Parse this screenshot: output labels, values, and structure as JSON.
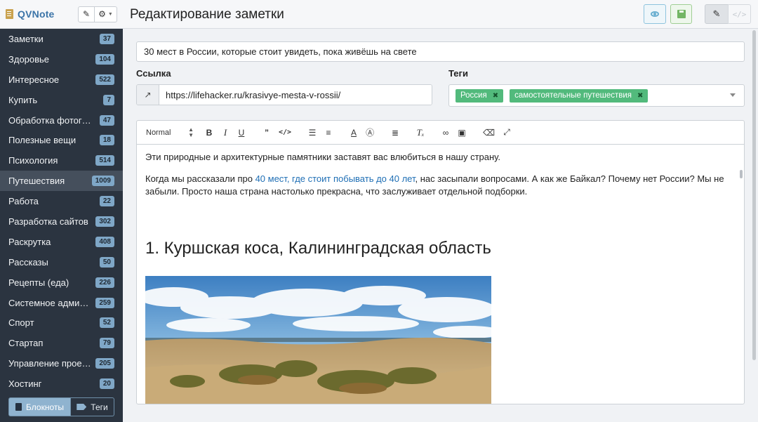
{
  "app": {
    "title": "QVNote"
  },
  "sidebar": {
    "items": [
      {
        "label": "Заметки",
        "count": "37"
      },
      {
        "label": "Здоровье",
        "count": "104"
      },
      {
        "label": "Интересное",
        "count": "522"
      },
      {
        "label": "Купить",
        "count": "7"
      },
      {
        "label": "Обработка фотографий",
        "count": "47"
      },
      {
        "label": "Полезные вещи",
        "count": "18"
      },
      {
        "label": "Психология",
        "count": "514"
      },
      {
        "label": "Путешествия",
        "count": "1009",
        "active": true
      },
      {
        "label": "Работа",
        "count": "22"
      },
      {
        "label": "Разработка сайтов",
        "count": "302"
      },
      {
        "label": "Раскрутка",
        "count": "408"
      },
      {
        "label": "Рассказы",
        "count": "50"
      },
      {
        "label": "Рецепты (еда)",
        "count": "226"
      },
      {
        "label": "Системное администрирование",
        "count": "259"
      },
      {
        "label": "Спорт",
        "count": "52"
      },
      {
        "label": "Стартап",
        "count": "79"
      },
      {
        "label": "Управление проектами",
        "count": "205"
      },
      {
        "label": "Хостинг",
        "count": "20"
      }
    ],
    "bottom": {
      "notebooks": "Блокноты",
      "tags": "Теги"
    }
  },
  "header": {
    "title": "Редактирование заметки"
  },
  "note": {
    "title": "30 мест в России, которые стоит увидеть, пока живёшь на свете",
    "link_label": "Ссылка",
    "link": "https://lifehacker.ru/krasivye-mesta-v-rossii/",
    "tags_label": "Теги",
    "tags": [
      "Россия",
      "самостоятельные путешествия"
    ]
  },
  "editor": {
    "format": "Normal",
    "toolbar_icons": [
      "bold-icon",
      "italic-icon",
      "underline-icon",
      "quote-icon",
      "code-icon",
      "ordered-list-icon",
      "bullet-list-icon",
      "font-color-icon",
      "background-color-icon",
      "align-icon",
      "clear-format-icon",
      "link-icon",
      "image-icon",
      "eraser-icon",
      "fullscreen-icon"
    ],
    "p1": "Эти природные и архитектурные памятники заставят вас влюбиться в нашу страну.",
    "p2_before": "Когда мы рассказали про ",
    "p2_link": "40 мест, где стоит побывать до 40 лет",
    "p2_after": ", нас засыпали вопросами. А как же Байкал? Почему нет России? Мы не забыли. Просто наша страна настолько прекрасна, что заслуживает отдельной подборки.",
    "heading": "1. Куршская коса, Калининградская область"
  },
  "colors": {
    "sidebar_bg": "#2b3440",
    "badge": "#7fa7c7",
    "tag_chip": "#52ba7c",
    "link": "#1f6fb5",
    "brand": "#3b74a8"
  }
}
